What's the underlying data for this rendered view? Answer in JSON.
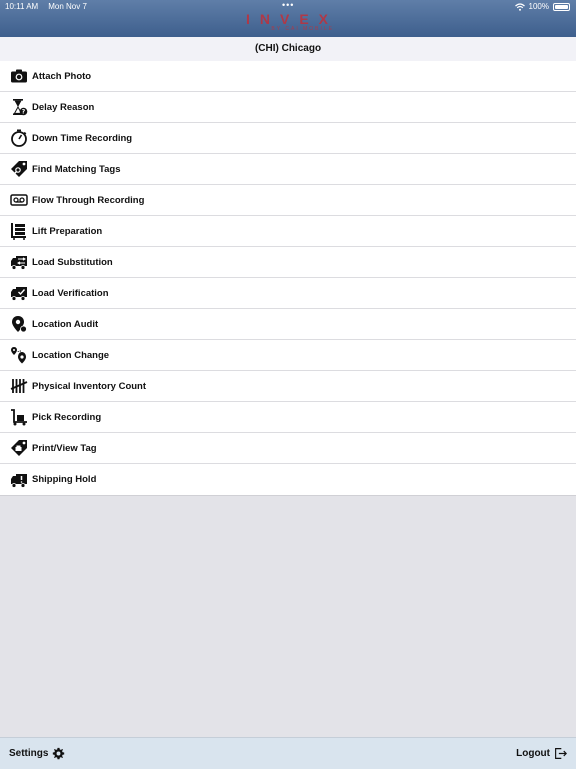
{
  "status_bar": {
    "time": "10:11 AM",
    "date": "Mon Nov 7",
    "dots": "•••",
    "battery": "100%"
  },
  "logo": {
    "main": "INVEX",
    "sub": "BY CAI MOBILE"
  },
  "location": "(CHI) Chicago",
  "menu": [
    {
      "label": "Attach Photo",
      "icon": "camera-icon"
    },
    {
      "label": "Delay Reason",
      "icon": "hourglass-question-icon"
    },
    {
      "label": "Down Time Recording",
      "icon": "stopwatch-icon"
    },
    {
      "label": "Find Matching Tags",
      "icon": "tag-search-icon"
    },
    {
      "label": "Flow Through Recording",
      "icon": "tape-icon"
    },
    {
      "label": "Lift Preparation",
      "icon": "lift-cart-icon"
    },
    {
      "label": "Load Substitution",
      "icon": "truck-swap-icon"
    },
    {
      "label": "Load Verification",
      "icon": "truck-check-icon"
    },
    {
      "label": "Location Audit",
      "icon": "location-pin-icon"
    },
    {
      "label": "Location Change",
      "icon": "location-route-icon"
    },
    {
      "label": "Physical Inventory Count",
      "icon": "tally-icon"
    },
    {
      "label": "Pick Recording",
      "icon": "hand-truck-icon"
    },
    {
      "label": "Print/View Tag",
      "icon": "tag-print-icon"
    },
    {
      "label": "Shipping Hold",
      "icon": "truck-hold-icon"
    }
  ],
  "footer": {
    "settings_label": "Settings",
    "logout_label": "Logout"
  }
}
